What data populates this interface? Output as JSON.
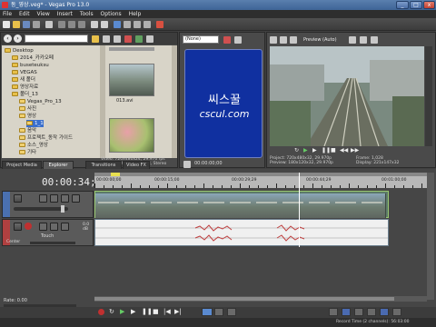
{
  "window": {
    "title": "동_영상.veg* - Vegas Pro 13.0"
  },
  "menu": [
    "File",
    "Edit",
    "View",
    "Insert",
    "Tools",
    "Options",
    "Help"
  ],
  "explorer": {
    "tree": [
      {
        "label": "Desktop",
        "level": 0
      },
      {
        "label": "2014_카카오페",
        "level": 1
      },
      {
        "label": "buseteuksu",
        "level": 1
      },
      {
        "label": "VEGAS",
        "level": 1
      },
      {
        "label": "새 폴더",
        "level": 1
      },
      {
        "label": "영상자료",
        "level": 1
      },
      {
        "label": "폴더_13",
        "level": 1
      },
      {
        "label": "Vegas_Pro_13",
        "level": 2
      },
      {
        "label": "사진",
        "level": 2
      },
      {
        "label": "영상",
        "level": 2
      },
      {
        "label": "1_1",
        "level": 3
      },
      {
        "label": "음악",
        "level": 2
      },
      {
        "label": "프로젝트_동작 가이드",
        "level": 2
      },
      {
        "label": "소스_영상",
        "level": 2
      },
      {
        "label": "기타",
        "level": 2
      }
    ],
    "file_label": "013.avi",
    "info_line1": "Video: 720x480x24, 29.970 fps",
    "info_line2": "Audio: 48,000 Hz, 16 Bit, Stereo",
    "tabs": [
      "Project Media",
      "Explorer",
      "Transitions",
      "Video FX"
    ]
  },
  "trimmer": {
    "dropdown": "(None)",
    "brand_korean": "씨스꿀",
    "brand_url": "cscul.com",
    "timecode": "00:00:00;00"
  },
  "preview": {
    "mode": "Preview (Auto)",
    "project": "Project:  720x480x32, 29.970p",
    "preview_res": "Preview:  180x120x32, 29.970p",
    "frame": "Frame:    1,028",
    "display": "Display:  221x147x32"
  },
  "timeline": {
    "timecode": "00:00:34;15",
    "ruler": [
      "00:00:00;00",
      "00:00:15;00",
      "00:00:29;29",
      "00:00:44;29",
      "00:01:00;00"
    ],
    "audio_db": "0.0 dB",
    "audio_pan": "Center",
    "audio_touch": "Touch",
    "rate": "Rate: 0.00",
    "status": "Record Time (2 channels): 56:03:00"
  },
  "colors": {
    "accent": "#5a7fae",
    "trimmer_blue": "#1030a0",
    "video_track": "#5c7a68",
    "audio_track": "#f0f0f0"
  }
}
